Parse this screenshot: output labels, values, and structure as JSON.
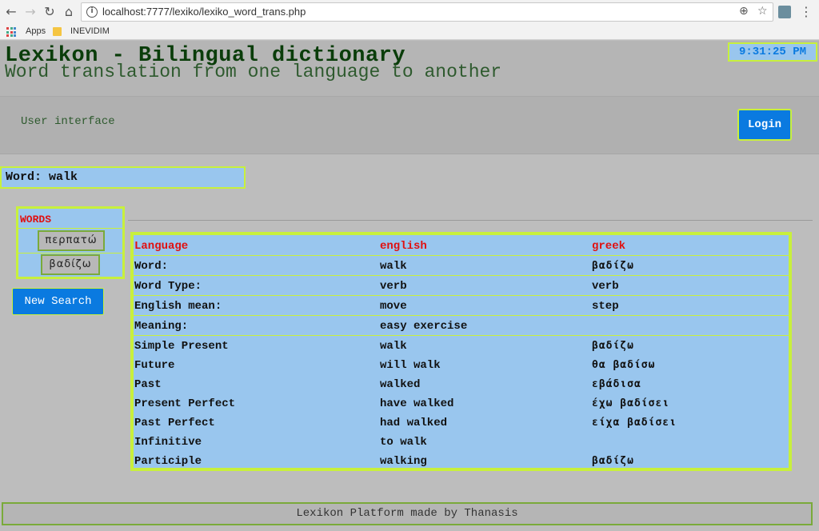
{
  "browser": {
    "url": "localhost:7777/lexiko/lexiko_word_trans.php",
    "bookmarks": [
      "Apps",
      "INEVIDIM"
    ]
  },
  "header": {
    "title": "Lexikon - Bilingual dictionary",
    "subtitle": "Word translation from one language to another",
    "clock": "9:31:25 PM"
  },
  "userbar": {
    "label": "User interface",
    "login_label": "Login"
  },
  "word_box": "Word: walk",
  "words_panel": {
    "heading": "WORDS",
    "items": [
      "περπατώ",
      "βαδίζω"
    ]
  },
  "new_search_label": "New Search",
  "table": {
    "header": [
      "Language",
      "english",
      "greek"
    ],
    "rows": [
      [
        "Word:",
        "walk",
        "βαδίζω"
      ],
      [
        "Word Type:",
        "verb",
        "verb"
      ],
      [
        "English mean:",
        "move",
        "step"
      ],
      [
        "Meaning:",
        "easy exercise",
        ""
      ],
      [
        "Simple Present",
        "walk",
        "βαδίζω"
      ],
      [
        "Future",
        "will walk",
        "θα βαδίσω"
      ],
      [
        "Past",
        "walked",
        "εβάδισα"
      ],
      [
        "Present Perfect",
        "have walked",
        "έχω βαδίσει"
      ],
      [
        "Past Perfect",
        "had walked",
        "είχα βαδίσει"
      ],
      [
        "Infinitive",
        "to walk",
        ""
      ],
      [
        "Participle",
        "walking",
        "βαδίζω"
      ]
    ]
  },
  "footer": "Lexikon Platform made by Thanasis"
}
